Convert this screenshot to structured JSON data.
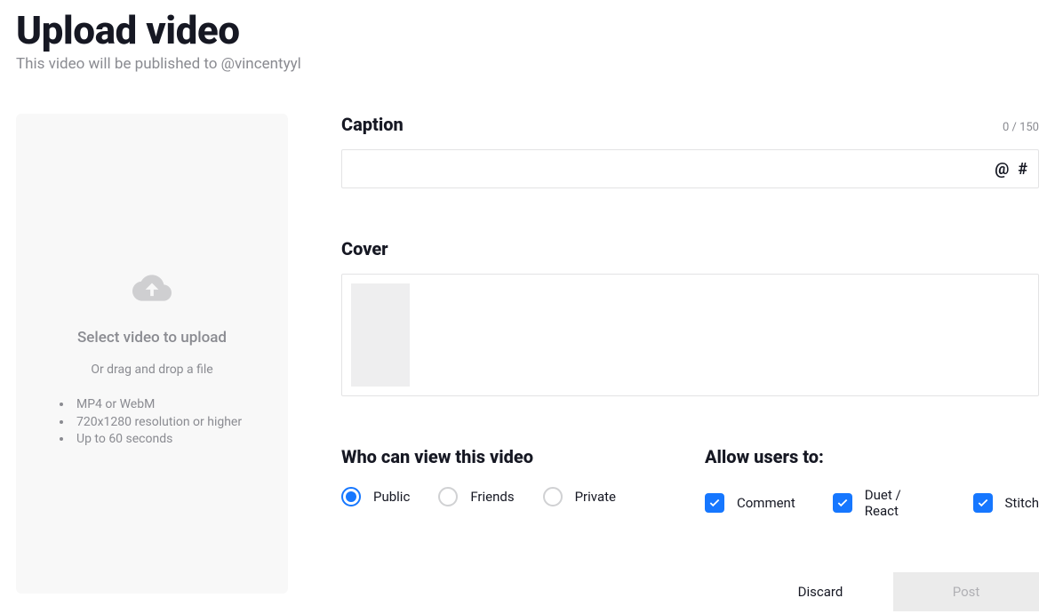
{
  "header": {
    "title": "Upload video",
    "subtitle": "This video will be published to @vincentyyl"
  },
  "upload": {
    "select": "Select video to upload",
    "drag": "Or drag and drop a file",
    "reqs": [
      "MP4 or WebM",
      "720x1280 resolution or higher",
      "Up to 60 seconds"
    ]
  },
  "caption": {
    "label": "Caption",
    "count": "0 / 150",
    "value": ""
  },
  "cover": {
    "label": "Cover"
  },
  "view": {
    "label": "Who can view this video",
    "options": [
      "Public",
      "Friends",
      "Private"
    ],
    "selected": 0
  },
  "allow": {
    "label": "Allow users to:",
    "options": [
      "Comment",
      "Duet / React",
      "Stitch"
    ]
  },
  "buttons": {
    "discard": "Discard",
    "post": "Post"
  }
}
